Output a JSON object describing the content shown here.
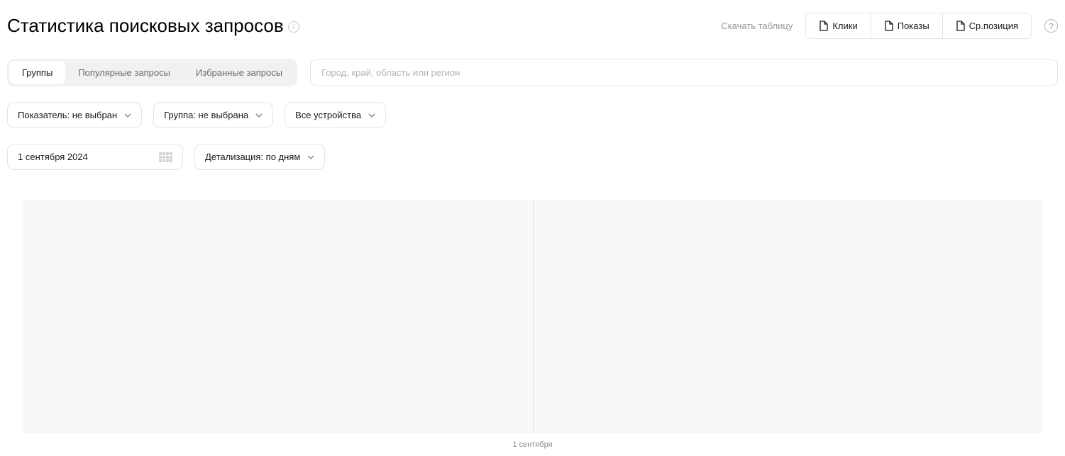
{
  "header": {
    "title": "Статистика поисковых запросов",
    "download_label": "Скачать таблицу",
    "export_buttons": {
      "clicks": "Клики",
      "impressions": "Показы",
      "avg_position": "Ср.позиция"
    }
  },
  "tabs": {
    "groups": "Группы",
    "popular": "Популярные запросы",
    "favorites": "Избранные запросы"
  },
  "search": {
    "placeholder": "Город, край, область или регион"
  },
  "controls": {
    "metric": "Показатель: не выбран",
    "group": "Группа: не выбрана",
    "device": "Все устройства"
  },
  "date": {
    "value": "1 сентября 2024",
    "detail": "Детализация: по дням"
  },
  "chart_data": {
    "type": "line",
    "categories": [
      "1 сентября"
    ],
    "series": [],
    "title": "",
    "xlabel": "",
    "ylabel": "",
    "x_tick_label": "1 сентября"
  }
}
